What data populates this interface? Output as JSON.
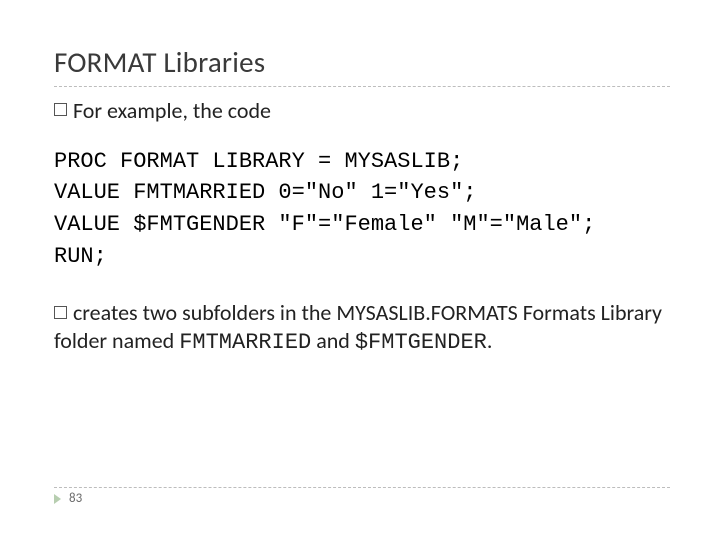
{
  "title": "FORMAT Libraries",
  "bullet1": "For example, the code",
  "code": "PROC FORMAT LIBRARY = MYSASLIB;\nVALUE FMTMARRIED 0=\"No\" 1=\"Yes\";\nVALUE $FMTGENDER \"F\"=\"Female\" \"M\"=\"Male\";\nRUN;",
  "bullet2_part1": "creates two subfolders in the MYSASLIB.FORMATS Formats Library folder named ",
  "bullet2_code1": "FMTMARRIED",
  "bullet2_mid": " and ",
  "bullet2_code2": "$FMTGENDER",
  "bullet2_end": ".",
  "page_number": "83"
}
